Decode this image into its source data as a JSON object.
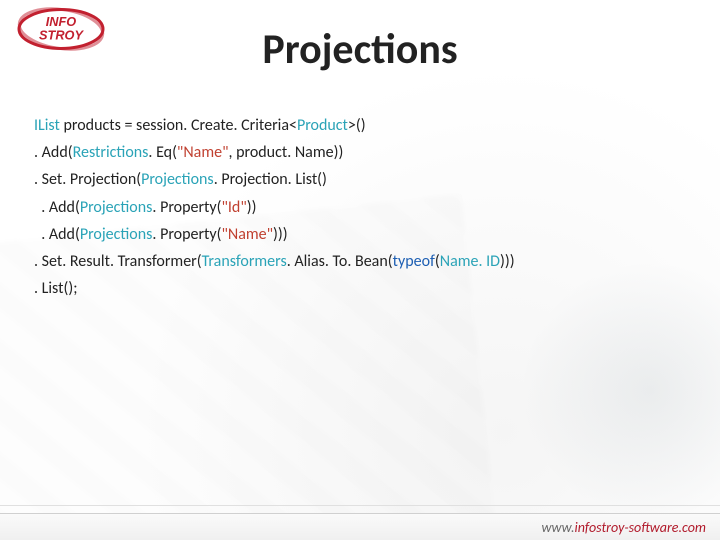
{
  "logo": {
    "top_text": "INFO",
    "bottom_text": "STROY"
  },
  "title": "Projections",
  "code": {
    "l1_a": "IList",
    "l1_b": " products = session. Create. Criteria<",
    "l1_c": "Product",
    "l1_d": ">()",
    "l2_a": ". Add(",
    "l2_b": "Restrictions",
    "l2_c": ". Eq(",
    "l2_d": "\"Name\"",
    "l2_e": ", product. Name))",
    "l3_a": ". Set. Projection(",
    "l3_b": "Projections",
    "l3_c": ". Projection. List()",
    "l4_a": "  . Add(",
    "l4_b": "Projections",
    "l4_c": ". Property(",
    "l4_d": "\"Id\"",
    "l4_e": "))",
    "l5_a": "  . Add(",
    "l5_b": "Projections",
    "l5_c": ". Property(",
    "l5_d": "\"Name\"",
    "l5_e": ")))",
    "l6_a": ". Set. Result. Transformer(",
    "l6_b": "Transformers",
    "l6_c": ". Alias. To. Bean(",
    "l6_d": "typeof",
    "l6_e": "(",
    "l6_f": "Name. ID",
    "l6_g": ")))",
    "l7": ". List();"
  },
  "footer": {
    "prefix": "www.",
    "url_display": "infostroy-software.com",
    "href": "http://www.infostroy-software.com"
  }
}
